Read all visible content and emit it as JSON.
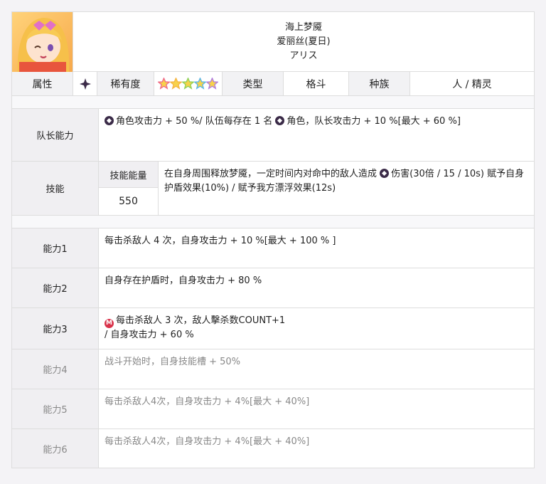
{
  "header": {
    "name_cn": "海上梦魇",
    "name_sub": "爱丽丝(夏日)",
    "name_jp": "アリス"
  },
  "attributes": {
    "attr_label": "属性",
    "attr_icon": "dark-element-icon",
    "rarity_label": "稀有度",
    "rarity_stars": 5,
    "type_label": "类型",
    "type_value": "格斗",
    "race_label": "种族",
    "race_value": "人 / 精灵"
  },
  "leader": {
    "label": "队长能力",
    "text_a": "角色攻击力 + 50 %/ 队伍每存在 1 名",
    "text_b": "角色，队长攻击力 + 10 %[最大 + 60 %]"
  },
  "skill": {
    "label": "技能",
    "energy_label": "技能能量",
    "energy_value": "550",
    "text_a": "在自身周围释放梦魇，一定时间内对命中的敌人造成",
    "text_b": "伤害(30倍 / 15 / 10s) 赋予自身护盾效果(10%) / 赋予我方漂浮效果(12s)"
  },
  "abilities": [
    {
      "label": "能力1",
      "text": "每击杀敌人 4 次，自身攻击力 + 10 %[最大 + 100 % ]"
    },
    {
      "label": "能力2",
      "text": "自身存在护盾时，自身攻击力 + 80 %"
    },
    {
      "label": "能力3",
      "line1": "每击杀敌人 3 次，敌人擊杀数COUNT+1",
      "line2": "/ 自身攻击力 + 60 %"
    },
    {
      "label": "能力4",
      "text": "战斗开始时，自身技能槽 + 50%"
    },
    {
      "label": "能力5",
      "text": "每击杀敌人4次，自身攻击力 + 4%[最大 + 40%]"
    },
    {
      "label": "能力6",
      "text": "每击杀敌人4次，自身攻击力 + 4%[最大 + 40%]"
    }
  ],
  "colors": {
    "dark_element": "#3b2b48",
    "m_icon": "#d9334b"
  }
}
